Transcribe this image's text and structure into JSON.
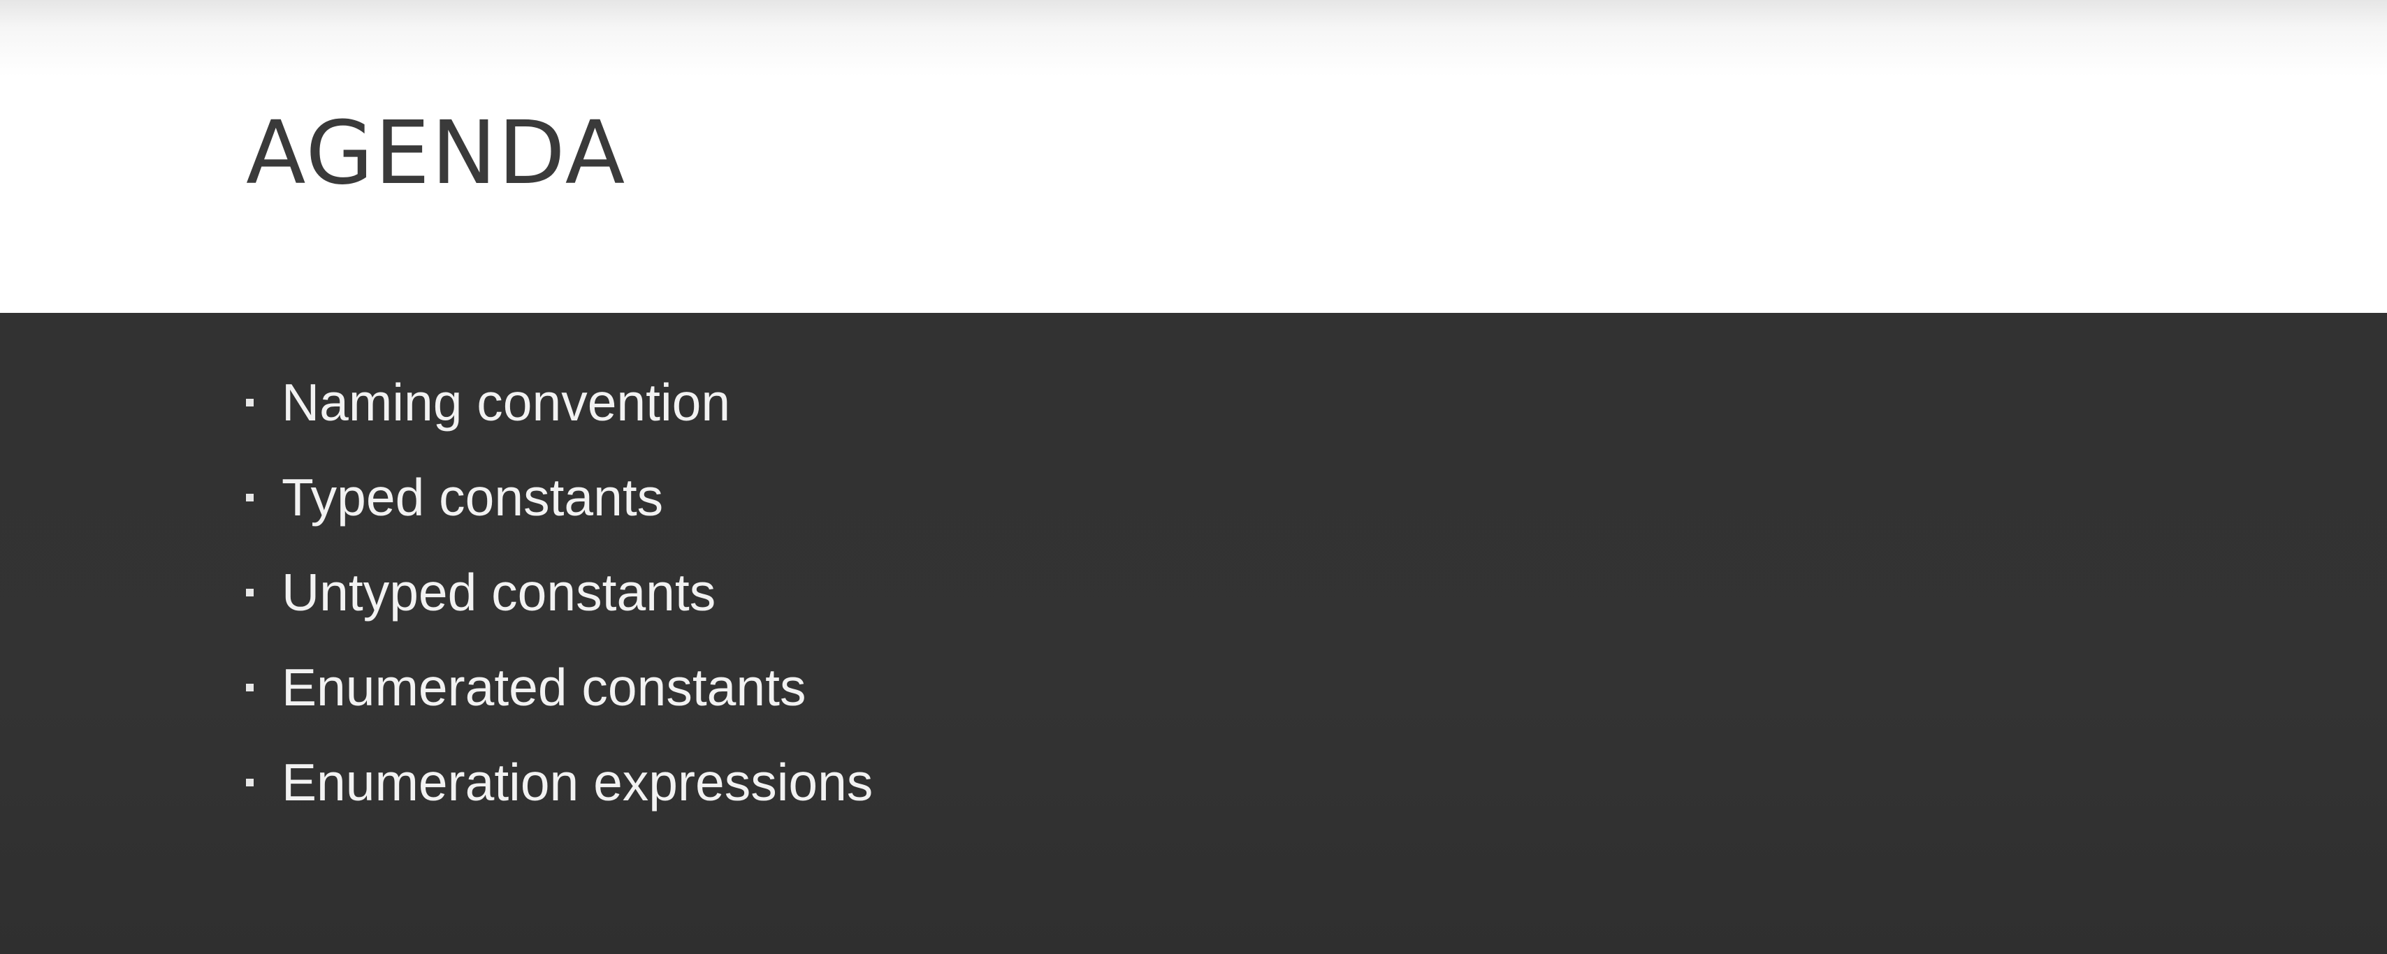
{
  "slide": {
    "title": "AGENDA",
    "bullets": [
      "Naming convention",
      "Typed constants",
      "Untyped constants",
      "Enumerated constants",
      "Enumeration expressions"
    ]
  },
  "colors": {
    "header_background": "#ffffff",
    "title_text": "#3a3a3a",
    "content_background": "#333333",
    "bullet_text": "#f2f2f2"
  }
}
